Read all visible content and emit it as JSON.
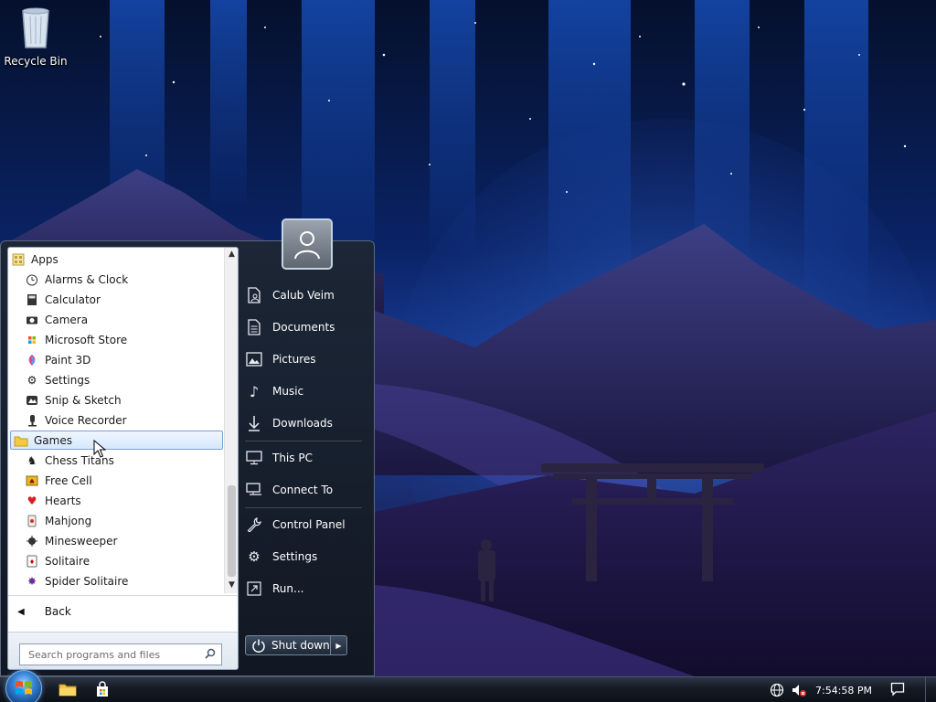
{
  "desktop": {
    "icons": [
      {
        "label": "Recycle Bin",
        "icon": "recycle-bin-icon"
      }
    ]
  },
  "start_menu": {
    "programs": [
      {
        "label": "Apps",
        "type": "folder",
        "icon": "apps-folder-icon"
      },
      {
        "label": "Alarms & Clock",
        "type": "app",
        "icon": "alarm-clock-icon"
      },
      {
        "label": "Calculator",
        "type": "app",
        "icon": "calculator-icon"
      },
      {
        "label": "Camera",
        "type": "app",
        "icon": "camera-icon"
      },
      {
        "label": "Microsoft Store",
        "type": "app",
        "icon": "store-icon"
      },
      {
        "label": "Paint 3D",
        "type": "app",
        "icon": "paint-3d-icon"
      },
      {
        "label": "Settings",
        "type": "app",
        "icon": "gear-icon"
      },
      {
        "label": "Snip & Sketch",
        "type": "app",
        "icon": "snip-sketch-icon"
      },
      {
        "label": "Voice Recorder",
        "type": "app",
        "icon": "microphone-icon"
      },
      {
        "label": "Games",
        "type": "folder",
        "icon": "folder-icon",
        "selected": true
      },
      {
        "label": "Chess Titans",
        "type": "app",
        "icon": "chess-icon"
      },
      {
        "label": "Free Cell",
        "type": "app",
        "icon": "freecell-icon"
      },
      {
        "label": "Hearts",
        "type": "app",
        "icon": "hearts-icon"
      },
      {
        "label": "Mahjong",
        "type": "app",
        "icon": "mahjong-icon"
      },
      {
        "label": "Minesweeper",
        "type": "app",
        "icon": "minesweeper-icon"
      },
      {
        "label": "Solitaire",
        "type": "app",
        "icon": "solitaire-icon"
      },
      {
        "label": "Spider Solitaire",
        "type": "app",
        "icon": "spider-solitaire-icon"
      }
    ],
    "back_label": "Back",
    "search_placeholder": "Search programs and files",
    "right_items": [
      {
        "label": "Calub Veim",
        "icon": "user-folder-icon"
      },
      {
        "label": "Documents",
        "icon": "document-icon"
      },
      {
        "label": "Pictures",
        "icon": "picture-icon"
      },
      {
        "label": "Music",
        "icon": "music-note-icon"
      },
      {
        "label": "Downloads",
        "icon": "download-arrow-icon"
      },
      {
        "label": "This PC",
        "icon": "monitor-icon"
      },
      {
        "label": "Connect To",
        "icon": "connect-icon"
      },
      {
        "label": "Control Panel",
        "icon": "wrench-icon"
      },
      {
        "label": "Settings",
        "icon": "gear-icon"
      },
      {
        "label": "Run...",
        "icon": "run-icon"
      }
    ],
    "shutdown_label": "Shut down"
  },
  "taskbar": {
    "pinned": [
      {
        "icon": "file-explorer-icon"
      },
      {
        "icon": "store-bag-icon"
      }
    ],
    "tray_icons": [
      "network-globe-icon",
      "volume-muted-icon"
    ],
    "clock": "7:54:58 PM",
    "notification_icon": "notification-icon"
  },
  "colors": {
    "selection_border": "#7da2ce",
    "menu_frame": "#1c2634",
    "taskbar": "#151b25"
  }
}
